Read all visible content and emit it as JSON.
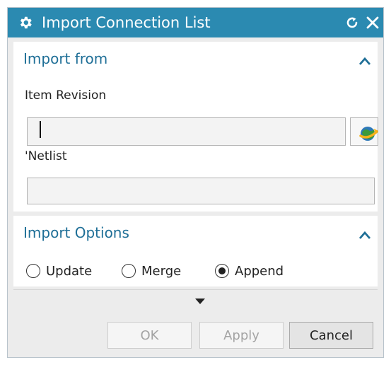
{
  "window": {
    "title": "Import Connection List",
    "icons": {
      "title": "gear-icon",
      "reset": "reset-icon",
      "close": "close-icon"
    },
    "colors": {
      "titlebar": "#2b8ab1",
      "section_title": "#1f6f97"
    }
  },
  "import_from": {
    "title": "Import from",
    "item_revision": {
      "label": "Item Revision",
      "value": ""
    },
    "netlist": {
      "label": "'Netlist",
      "value": ""
    },
    "browse_icon": "browse-icon"
  },
  "import_options": {
    "title": "Import Options",
    "options": [
      {
        "label": "Update",
        "selected": false
      },
      {
        "label": "Merge",
        "selected": false
      },
      {
        "label": "Append",
        "selected": true
      }
    ]
  },
  "footer": {
    "ok_label": "OK",
    "apply_label": "Apply",
    "cancel_label": "Cancel"
  }
}
